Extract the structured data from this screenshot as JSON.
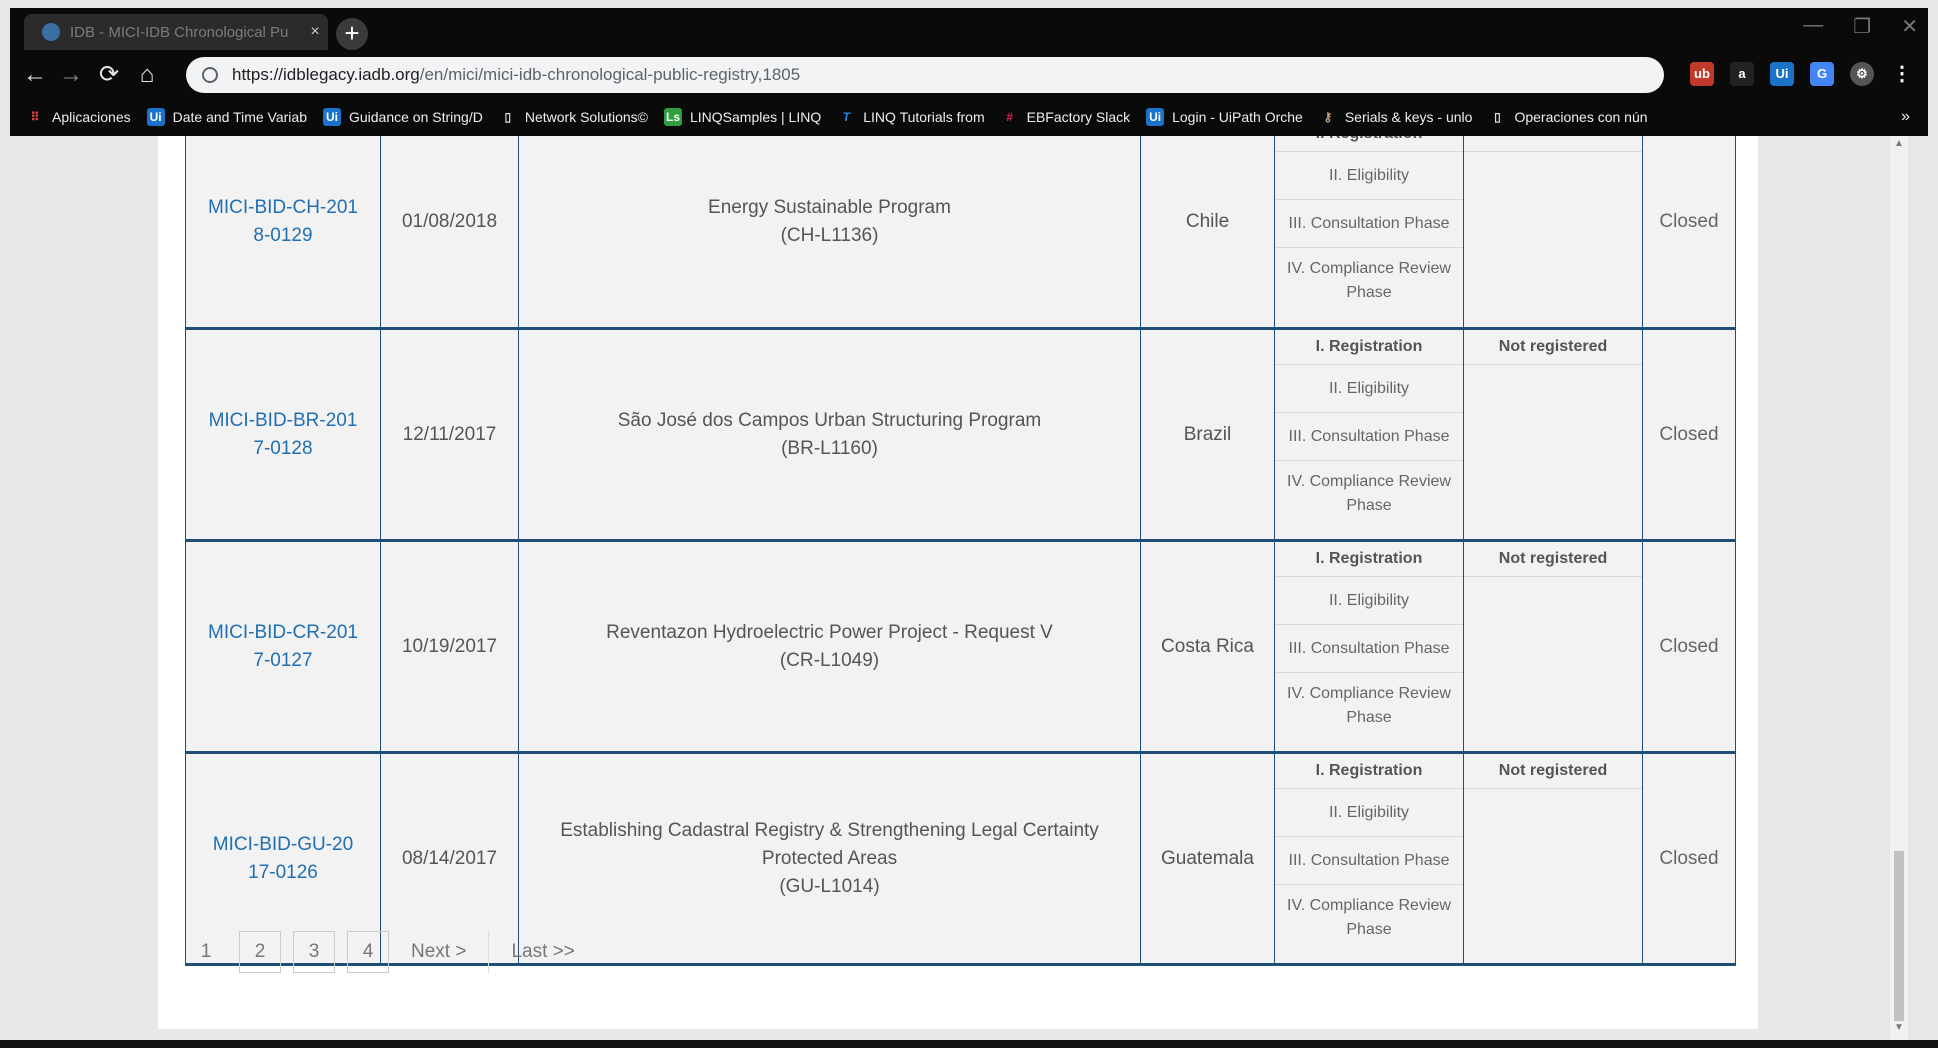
{
  "browser": {
    "tab_title": "IDB - MICI-IDB Chronological Pu",
    "tab_close": "×",
    "new_tab": "+",
    "url_host": "https://idblegacy.iadb.org",
    "url_path": "/en/mici/mici-idb-chronological-public-registry,1805",
    "nav": {
      "back": "←",
      "forward": "→",
      "reload": "⟳",
      "home": "⌂"
    },
    "window_controls": {
      "minimize": "—",
      "restore": "❐",
      "close": "✕"
    },
    "extensions": [
      {
        "label": "ub",
        "color": "#c0392b"
      },
      {
        "label": "a",
        "color": "#222222"
      },
      {
        "label": "Ui",
        "color": "#1a73c8"
      },
      {
        "label": "G",
        "color": "#4285f4"
      },
      {
        "label": "⚙",
        "color": "#555555"
      }
    ],
    "menu": "⋮",
    "bookmarks": [
      {
        "label": "Aplicaciones",
        "icon": "apps-icon",
        "glyph": "⠿",
        "color": "#e44"
      },
      {
        "label": "Date and Time Variab",
        "icon": "uipath-icon",
        "glyph": "Ui",
        "color": "#1a73c8"
      },
      {
        "label": "Guidance on String/D",
        "icon": "uipath-icon",
        "glyph": "Ui",
        "color": "#1a73c8"
      },
      {
        "label": "Network Solutions©",
        "icon": "page-icon",
        "glyph": "▯",
        "color": "#444"
      },
      {
        "label": "LINQSamples | LINQ",
        "icon": "linq-icon",
        "glyph": "Ls",
        "color": "#2e9e3e"
      },
      {
        "label": "LINQ Tutorials from",
        "icon": "tutorial-icon",
        "glyph": "T",
        "color": "#1e88e5"
      },
      {
        "label": "EBFactory Slack",
        "icon": "slack-icon",
        "glyph": "#",
        "color": "#611f69"
      },
      {
        "label": "Login - UiPath Orche",
        "icon": "uipath-icon",
        "glyph": "Ui",
        "color": "#1a73c8"
      },
      {
        "label": "Serials & keys - unlo",
        "icon": "serials-icon",
        "glyph": "⚷",
        "color": "#8e6b4a"
      },
      {
        "label": "Operaciones con nún",
        "icon": "page-icon",
        "glyph": "▯",
        "color": "#444"
      }
    ],
    "bookmarks_more": "»"
  },
  "registry": {
    "rows": [
      {
        "code": "MICI-BID-CH-2018-0129",
        "date": "01/08/2018",
        "project": "Energy Sustainable Program",
        "project_code": "(CH-L1136)",
        "country": "Chile",
        "phases": [
          "I. Registration",
          "II. Eligibility",
          "III. Consultation Phase",
          "IV. Compliance Review Phase"
        ],
        "registration": "",
        "status": "Closed"
      },
      {
        "code": "MICI-BID-BR-2017-0128",
        "date": "12/11/2017",
        "project": "São José dos Campos Urban Structuring Program",
        "project_code": "(BR-L1160)",
        "country": "Brazil",
        "phases": [
          "I. Registration",
          "II. Eligibility",
          "III. Consultation Phase",
          "IV. Compliance Review Phase"
        ],
        "registration": "Not registered",
        "status": "Closed"
      },
      {
        "code": "MICI-BID-CR-2017-0127",
        "date": "10/19/2017",
        "project": "Reventazon Hydroelectric Power Project - Request V",
        "project_code": "(CR-L1049)",
        "country": "Costa Rica",
        "phases": [
          "I. Registration",
          "II. Eligibility",
          "III. Consultation Phase",
          "IV. Compliance Review Phase"
        ],
        "registration": "Not registered",
        "status": "Closed"
      },
      {
        "code": "MICI-BID-GU-2017-0126",
        "date": "08/14/2017",
        "project": "Establishing Cadastral Registry & Strengthening Legal Certainty Protected Areas",
        "project_code": "(GU-L1014)",
        "country": "Guatemala",
        "phases": [
          "I. Registration",
          "II. Eligibility",
          "III. Consultation Phase",
          "IV. Compliance Review Phase"
        ],
        "registration": "Not registered",
        "status": "Closed"
      }
    ]
  },
  "pagination": {
    "current": "1",
    "pages": [
      "2",
      "3",
      "4"
    ],
    "next": "Next >",
    "last": "Last >>"
  }
}
